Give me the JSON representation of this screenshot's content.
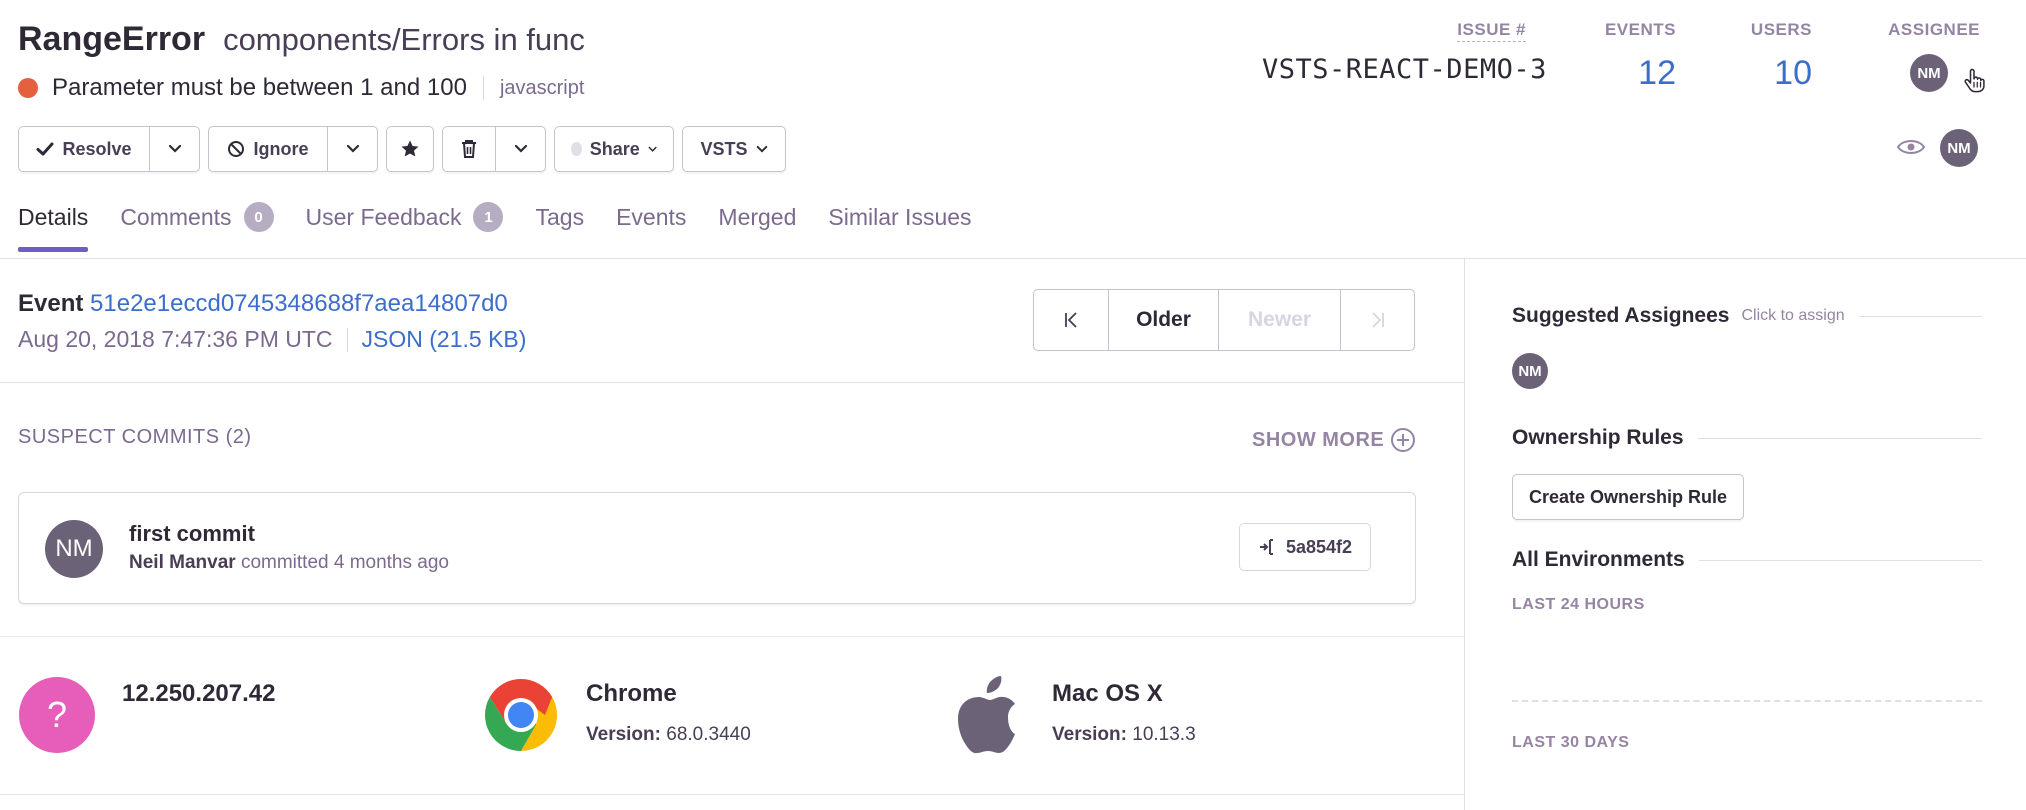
{
  "issue": {
    "error_type": "RangeError",
    "culprit": "components/Errors in func",
    "message": "Parameter must be between 1 and 100",
    "platform": "javascript",
    "level_color": "#e5603f"
  },
  "stats": {
    "issue_label": "ISSUE #",
    "issue_value": "VSTS-REACT-DEMO-3",
    "events_label": "EVENTS",
    "events_value": "12",
    "users_label": "USERS",
    "users_value": "10",
    "assignee_label": "ASSIGNEE",
    "assignee_initials": "NM"
  },
  "subscriber_initials": "NM",
  "actions": {
    "resolve": "Resolve",
    "ignore": "Ignore",
    "share": "Share",
    "vsts": "VSTS"
  },
  "tabs": [
    {
      "label": "Details"
    },
    {
      "label": "Comments",
      "count": "0"
    },
    {
      "label": "User Feedback",
      "count": "1"
    },
    {
      "label": "Tags"
    },
    {
      "label": "Events"
    },
    {
      "label": "Merged"
    },
    {
      "label": "Similar Issues"
    }
  ],
  "event": {
    "label": "Event",
    "id": "51e2e1eccd0745348688f7aea14807d0",
    "date": "Aug 20, 2018 7:47:36 PM UTC",
    "json_link": "JSON (21.5 KB)"
  },
  "pager": {
    "oldest": "K",
    "older": "Older",
    "newer": "Newer",
    "newest": ">|"
  },
  "suspect_commits": {
    "title": "SUSPECT COMMITS (2)",
    "show_more": "SHOW MORE",
    "commit": {
      "author_initials": "NM",
      "message": "first commit",
      "author": "Neil Manvar",
      "meta": "committed 4 months ago",
      "sha": "5a854f2"
    }
  },
  "context": {
    "user": {
      "name": "12.250.207.42",
      "icon_text": "?"
    },
    "browser": {
      "name": "Chrome",
      "version_label": "Version:",
      "version": "68.0.3440"
    },
    "os": {
      "name": "Mac OS X",
      "version_label": "Version:",
      "version": "10.13.3"
    }
  },
  "sidebar": {
    "suggested_title": "Suggested Assignees",
    "suggested_hint": "Click to assign",
    "suggested_initials": "NM",
    "ownership_title": "Ownership Rules",
    "ownership_button": "Create Ownership Rule",
    "env_title": "All Environments",
    "last_24": "LAST 24 HOURS",
    "last_30": "LAST 30 DAYS"
  },
  "colors": {
    "accent": "#6c5fc7",
    "link": "#3b6ecc",
    "unknown_user": "#e65dba"
  },
  "icons": [
    "checkmark-icon",
    "chevron-down-icon",
    "ignore-icon",
    "star-icon",
    "trash-icon",
    "eye-icon",
    "hand-cursor-icon",
    "plus-circle-icon",
    "commit-icon",
    "chrome-icon",
    "apple-icon"
  ]
}
